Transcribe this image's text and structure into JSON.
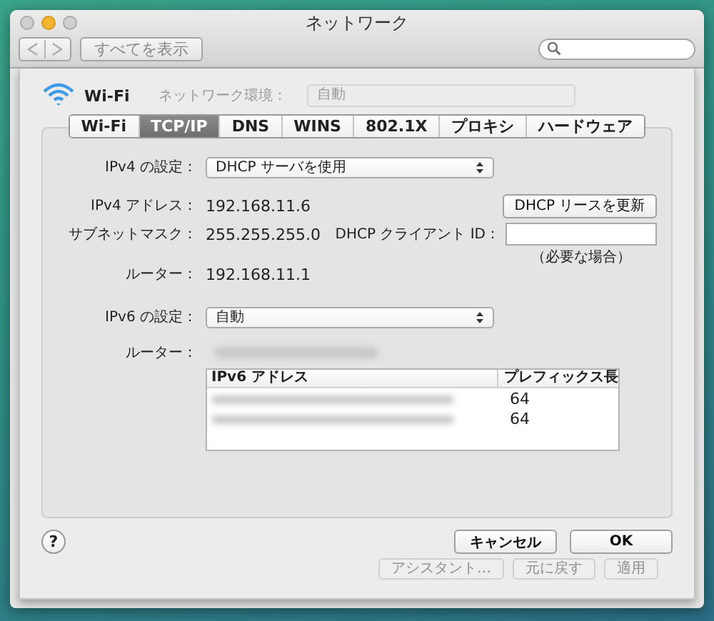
{
  "window": {
    "title": "ネットワーク"
  },
  "toolbar": {
    "show_all": "すべてを表示"
  },
  "service": {
    "name": "Wi-Fi"
  },
  "location": {
    "label": "ネットワーク環境：",
    "value": "自動"
  },
  "tabs": [
    {
      "label": "Wi-Fi",
      "selected": false
    },
    {
      "label": "TCP/IP",
      "selected": true
    },
    {
      "label": "DNS",
      "selected": false
    },
    {
      "label": "WINS",
      "selected": false
    },
    {
      "label": "802.1X",
      "selected": false
    },
    {
      "label": "プロキシ",
      "selected": false
    },
    {
      "label": "ハードウェア",
      "selected": false
    }
  ],
  "ipv4": {
    "config_label": "IPv4 の設定：",
    "config_value": "DHCP サーバを使用",
    "address_label": "IPv4 アドレス：",
    "address": "192.168.11.6",
    "renew_button": "DHCP リースを更新",
    "subnet_label": "サブネットマスク：",
    "subnet": "255.255.255.0",
    "client_id_label": "DHCP クライアント ID：",
    "client_id_hint": "（必要な場合）",
    "router_label": "ルーター：",
    "router": "192.168.11.1"
  },
  "ipv6": {
    "config_label": "IPv6 の設定：",
    "config_value": "自動",
    "router_label": "ルーター：",
    "columns": [
      "IPv6 アドレス",
      "プレフィックス長"
    ],
    "rows": [
      {
        "prefix": "64"
      },
      {
        "prefix": "64"
      }
    ]
  },
  "buttons": {
    "help": "?",
    "cancel": "キャンセル",
    "ok": "OK"
  },
  "background_buttons": [
    "アシスタント…",
    "元に戻す",
    "適用"
  ]
}
